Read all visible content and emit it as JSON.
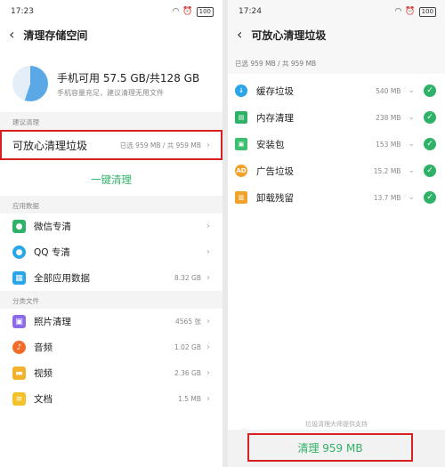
{
  "left": {
    "status": {
      "time": "17:23",
      "net": "5G ᵢₗ",
      "battery": "100"
    },
    "title": "清理存储空间",
    "storage": {
      "main": "手机可用 57.5 GB/共128 GB",
      "sub": "手机容量充足，建议清理无用文件"
    },
    "sections": {
      "suggest": "建议清理",
      "apps": "应用数据",
      "files": "分类文件"
    },
    "safe_clean": {
      "label": "可放心清理垃圾",
      "value": "已选 959 MB / 共 959 MB"
    },
    "one_key": "一键清理",
    "apps": [
      {
        "label": "微信专清",
        "value": ""
      },
      {
        "label": "QQ 专清",
        "value": ""
      },
      {
        "label": "全部应用数据",
        "value": "8.32 GB"
      }
    ],
    "files": [
      {
        "label": "照片清理",
        "value": "4565 张"
      },
      {
        "label": "音频",
        "value": "1.02 GB"
      },
      {
        "label": "视频",
        "value": "2.36 GB"
      },
      {
        "label": "文档",
        "value": "1.5 MB"
      }
    ]
  },
  "right": {
    "status": {
      "time": "17:24",
      "net": "5G ᵢₗ",
      "battery": "100"
    },
    "title": "可放心清理垃圾",
    "summary": "已选 959 MB / 共 959 MB",
    "items": [
      {
        "label": "缓存垃圾",
        "value": "540 MB",
        "color": "#2aa6e8"
      },
      {
        "label": "内存清理",
        "value": "238 MB",
        "color": "#2fb267"
      },
      {
        "label": "安装包",
        "value": "153 MB",
        "color": "#3cbf6e"
      },
      {
        "label": "广告垃圾",
        "value": "15.2 MB",
        "color": "#f2a22a"
      },
      {
        "label": "卸载残留",
        "value": "13.7 MB",
        "color": "#f2a22a"
      }
    ],
    "hint": "垃圾清理大师提供支持",
    "clean_button": "清理 959 MB"
  },
  "colors": {
    "accent": "#2fb267",
    "highlight": "#d82020"
  }
}
